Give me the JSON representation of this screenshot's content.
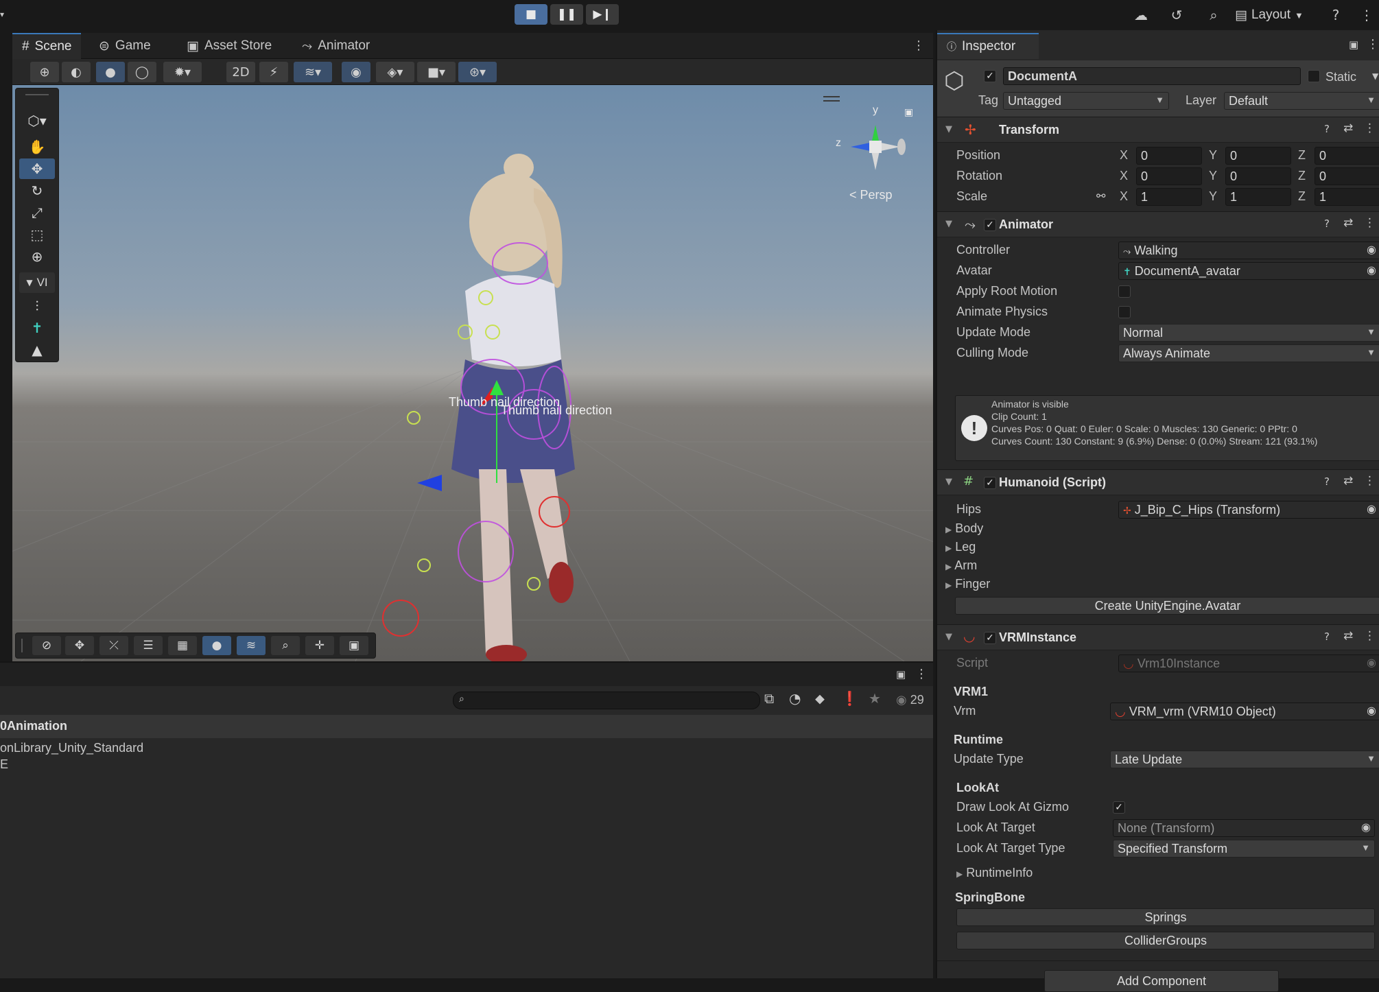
{
  "toolbar": {
    "play_icons": [
      "stop",
      "pause",
      "step"
    ],
    "layout_label": "Layout",
    "icons": [
      "cloud-icon",
      "history-icon",
      "search-icon",
      "layout-icon",
      "help-icon",
      "more-icon"
    ]
  },
  "scene_tabs": [
    {
      "label": "Scene",
      "icon": "#"
    },
    {
      "label": "Game",
      "icon": "gamepad"
    },
    {
      "label": "Asset Store",
      "icon": "bag"
    },
    {
      "label": "Animator",
      "icon": "animator"
    }
  ],
  "viewport": {
    "persp_label": "Persp",
    "gizmo_axes": {
      "y": "y",
      "z": "z"
    },
    "overlay_texts": [
      "Thumb nail direction",
      "Thumb nail direction"
    ],
    "left_tools_dropdown": "VI"
  },
  "project": {
    "count": "29",
    "rows": [
      "0Animation",
      "onLibrary_Unity_Standard",
      "E"
    ]
  },
  "inspector": {
    "tab_label": "Inspector",
    "object_name": "DocumentA",
    "static_label": "Static",
    "tag_label": "Tag",
    "tag_value": "Untagged",
    "layer_label": "Layer",
    "layer_value": "Default",
    "transform": {
      "title": "Transform",
      "position_label": "Position",
      "rotation_label": "Rotation",
      "scale_label": "Scale",
      "position": [
        "0",
        "0",
        "0"
      ],
      "rotation": [
        "0",
        "0",
        "0"
      ],
      "scale": [
        "1",
        "1",
        "1"
      ],
      "axis_labels": [
        "X",
        "Y",
        "Z"
      ]
    },
    "animator": {
      "title": "Animator",
      "controller_label": "Controller",
      "controller_value": "Walking",
      "avatar_label": "Avatar",
      "avatar_value": "DocumentA_avatar",
      "apply_root_motion_label": "Apply Root Motion",
      "animate_physics_label": "Animate Physics",
      "update_mode_label": "Update Mode",
      "update_mode_value": "Normal",
      "culling_mode_label": "Culling Mode",
      "culling_mode_value": "Always Animate",
      "info": [
        "Animator is visible",
        "Clip Count: 1",
        "Curves Pos: 0 Quat: 0 Euler: 0 Scale: 0 Muscles: 130 Generic: 0 PPtr: 0",
        "Curves Count: 130 Constant: 9 (6.9%) Dense: 0 (0.0%) Stream: 121 (93.1%)"
      ]
    },
    "humanoid": {
      "title": "Humanoid (Script)",
      "hips_label": "Hips",
      "hips_value": "J_Bip_C_Hips (Transform)",
      "foldouts": [
        "Body",
        "Leg",
        "Arm",
        "Finger"
      ],
      "create_button": "Create UnityEngine.Avatar"
    },
    "vrm": {
      "title": "VRMInstance",
      "script_label": "Script",
      "script_value": "Vrm10Instance",
      "vrm1_header": "VRM1",
      "vrm_label": "Vrm",
      "vrm_value": "VRM_vrm (VRM10 Object)",
      "runtime_header": "Runtime",
      "update_type_label": "Update Type",
      "update_type_value": "Late Update",
      "lookat_header": "LookAt",
      "draw_gizmo_label": "Draw Look At Gizmo",
      "target_label": "Look At Target",
      "target_value": "None (Transform)",
      "target_type_label": "Look At Target Type",
      "target_type_value": "Specified Transform",
      "runtime_info": "RuntimeInfo",
      "springbone_header": "SpringBone",
      "springs_button": "Springs",
      "collider_groups_button": "ColliderGroups"
    },
    "add_component": "Add Component"
  },
  "colors": {
    "accent": "#3a79bb",
    "panel": "#282828",
    "header": "#191919"
  }
}
